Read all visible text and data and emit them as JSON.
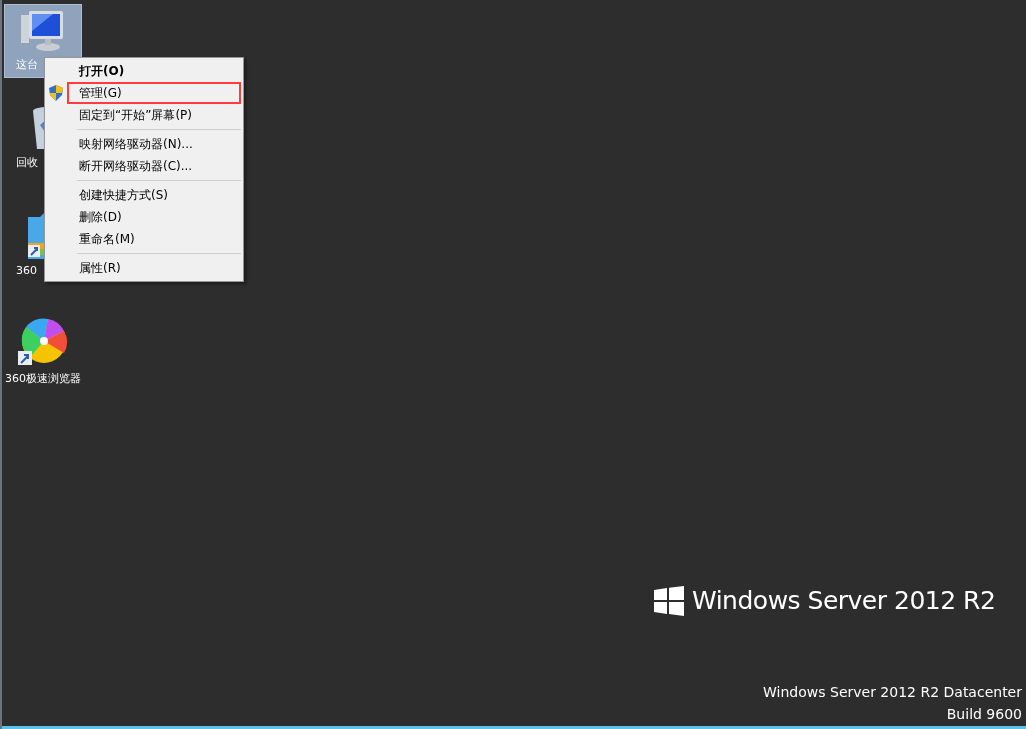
{
  "desktop_icons": [
    {
      "kind": "computer",
      "label": "这台",
      "selected": true
    },
    {
      "kind": "recycle",
      "label": "回收",
      "selected": false
    },
    {
      "kind": "archive",
      "label": "360",
      "selected": false
    },
    {
      "kind": "browser",
      "label": "360极速浏览器",
      "selected": false
    }
  ],
  "context_menu": [
    {
      "kind": "item",
      "label": "打开(O)",
      "bold": true,
      "shield": false,
      "highlighted": false
    },
    {
      "kind": "item",
      "label": "管理(G)",
      "bold": false,
      "shield": true,
      "highlighted": true
    },
    {
      "kind": "item",
      "label": "固定到“开始”屏幕(P)",
      "bold": false,
      "shield": false,
      "highlighted": false
    },
    {
      "kind": "separator"
    },
    {
      "kind": "item",
      "label": "映射网络驱动器(N)...",
      "bold": false,
      "shield": false,
      "highlighted": false
    },
    {
      "kind": "item",
      "label": "断开网络驱动器(C)...",
      "bold": false,
      "shield": false,
      "highlighted": false
    },
    {
      "kind": "separator"
    },
    {
      "kind": "item",
      "label": "创建快捷方式(S)",
      "bold": false,
      "shield": false,
      "highlighted": false
    },
    {
      "kind": "item",
      "label": "删除(D)",
      "bold": false,
      "shield": false,
      "highlighted": false
    },
    {
      "kind": "item",
      "label": "重命名(M)",
      "bold": false,
      "shield": false,
      "highlighted": false
    },
    {
      "kind": "separator"
    },
    {
      "kind": "item",
      "label": "属性(R)",
      "bold": false,
      "shield": false,
      "highlighted": false
    }
  ],
  "brand": "Windows Server 2012 R2",
  "watermark": [
    "Windows Server 2012 R2 Datacenter",
    "Build 9600"
  ]
}
